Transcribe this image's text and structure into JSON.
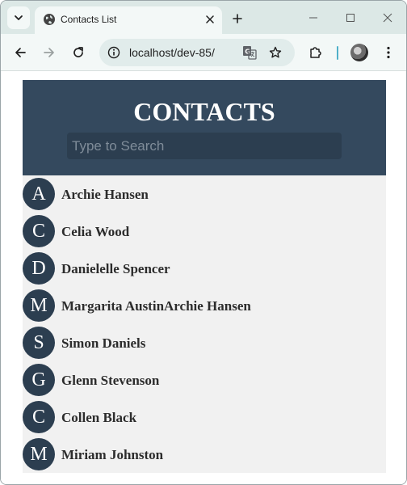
{
  "browser": {
    "tab_title": "Contacts List",
    "url": "localhost/dev-85/"
  },
  "app": {
    "title": "CONTACTS",
    "search_placeholder": "Type to Search",
    "contacts": [
      {
        "initial": "A",
        "name": "Archie Hansen"
      },
      {
        "initial": "C",
        "name": "Celia Wood"
      },
      {
        "initial": "D",
        "name": "Danielelle Spencer"
      },
      {
        "initial": "M",
        "name": "Margarita AustinArchie Hansen"
      },
      {
        "initial": "S",
        "name": "Simon Daniels"
      },
      {
        "initial": "G",
        "name": "Glenn Stevenson"
      },
      {
        "initial": "C",
        "name": "Collen Black"
      },
      {
        "initial": "M",
        "name": "Miriam Johnston"
      }
    ]
  },
  "colors": {
    "header_bg": "#34495e",
    "avatar_bg": "#2c3e50",
    "list_bg": "#f1f1f1"
  }
}
